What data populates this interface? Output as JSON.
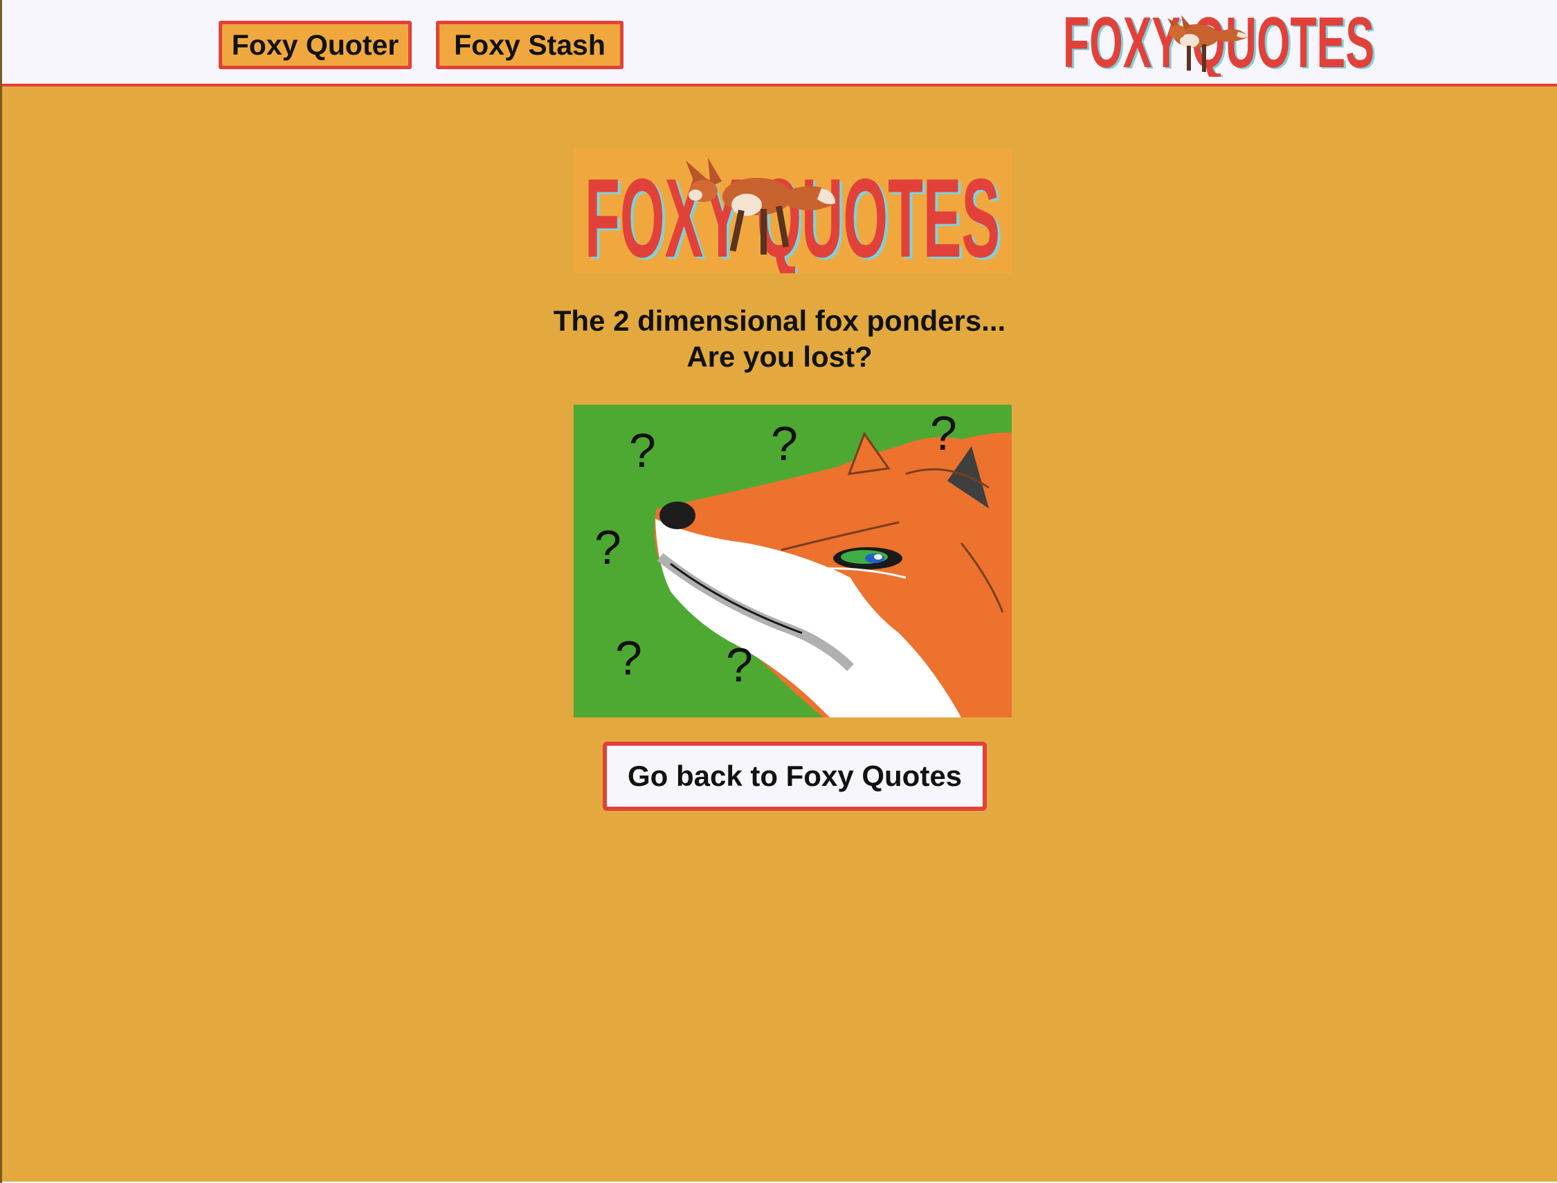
{
  "nav": {
    "quoter_label": "Foxy Quoter",
    "stash_label": "Foxy Stash"
  },
  "logo": {
    "text": "FOXY QUOTES",
    "icon": "fox-logo-icon"
  },
  "main": {
    "line1": "The 2 dimensional fox ponders...",
    "line2": "Are you lost?",
    "image_icon": "confused-fox-drawing",
    "back_label": "Go back to Foxy Quotes"
  },
  "colors": {
    "background": "#e3a93e",
    "header": "#f8f6fd",
    "accent_red": "#e2413a",
    "button_orange": "#f0a83e"
  }
}
